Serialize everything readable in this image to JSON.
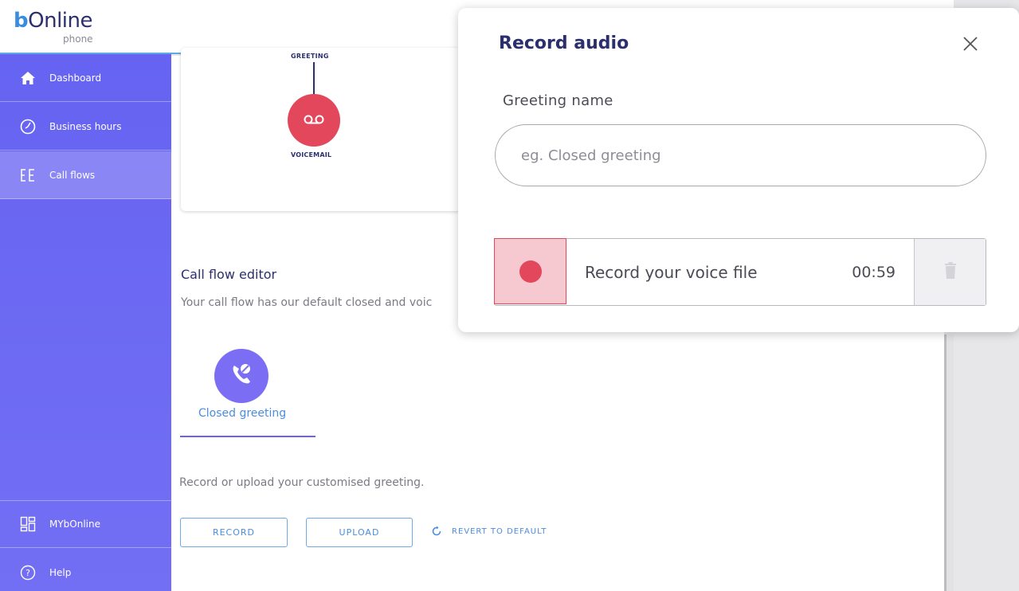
{
  "app": {
    "logo_brand": "bOnline",
    "logo_sub": "phone"
  },
  "sidebar": {
    "items": [
      {
        "label": "Dashboard",
        "icon": "home-icon"
      },
      {
        "label": "Business hours",
        "icon": "clock-icon"
      },
      {
        "label": "Call flows",
        "icon": "call-flows-icon"
      }
    ],
    "bottom_items": [
      {
        "label": "MYbOnline",
        "icon": "dashboard-grid-icon"
      },
      {
        "label": "Help",
        "icon": "help-icon"
      }
    ]
  },
  "flow_preview": {
    "top_node_label": "GREETING",
    "node_label": "VOICEMAIL"
  },
  "editor": {
    "title": "Call flow editor",
    "description": "Your call flow has our default closed and voic",
    "greeting_tab_label": "Closed greeting",
    "upload_description": "Record or upload your customised greeting.",
    "record_button": "RECORD",
    "upload_button": "UPLOAD",
    "revert_button": "REVERT TO DEFAULT"
  },
  "modal": {
    "title": "Record audio",
    "field_label": "Greeting name",
    "field_placeholder": "eg. Closed greeting",
    "field_value": "",
    "record_prompt": "Record your voice file",
    "record_time": "00:59"
  },
  "colors": {
    "sidebar": "#6663f2",
    "accent": "#4a8de0",
    "record_red": "#e3475c",
    "title_navy": "#2c2f6e"
  }
}
